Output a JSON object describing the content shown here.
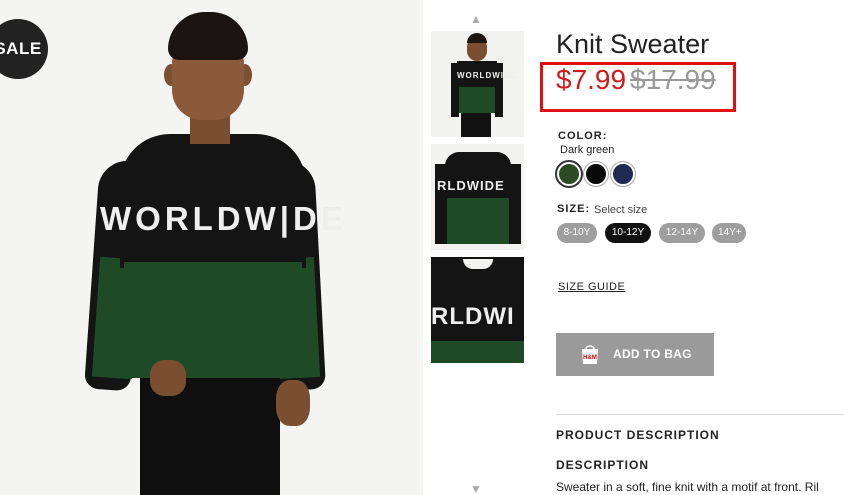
{
  "badge": {
    "sale": "SALE"
  },
  "main_image": {
    "motif_text": "WORLDWIDE",
    "motif_visible": "WORLDW|DE"
  },
  "thumbnails": [
    {
      "motif": "WORLDWIDE"
    },
    {
      "motif": "RLDWIDE"
    },
    {
      "motif": "RLDWI"
    }
  ],
  "product": {
    "title": "Knit Sweater",
    "price_sale": "$7.99",
    "price_original": "$17.99"
  },
  "color": {
    "label": "COLOR:",
    "value": "Dark green",
    "swatches": [
      {
        "name": "Dark green",
        "hex": "#2c4b25",
        "selected": true
      },
      {
        "name": "Black",
        "hex": "#0a0a0a",
        "selected": false
      },
      {
        "name": "Navy",
        "hex": "#1d2a52",
        "selected": false
      }
    ]
  },
  "size": {
    "label": "SIZE:",
    "hint": "Select size",
    "options": [
      "8-10Y",
      "10-12Y",
      "12-14Y",
      "14Y+"
    ],
    "selected": "10-12Y"
  },
  "links": {
    "size_guide": "SIZE GUIDE"
  },
  "cart": {
    "add_label": "ADD TO BAG",
    "brand_mark": "H&M"
  },
  "description": {
    "section_heading": "PRODUCT DESCRIPTION",
    "heading": "DESCRIPTION",
    "text": "Sweater in a soft, fine knit with a motif at front. Ril"
  },
  "colors": {
    "sale_red": "#d11b1b",
    "highlight_red": "#e01010",
    "button_grey": "#9a9a9a"
  }
}
